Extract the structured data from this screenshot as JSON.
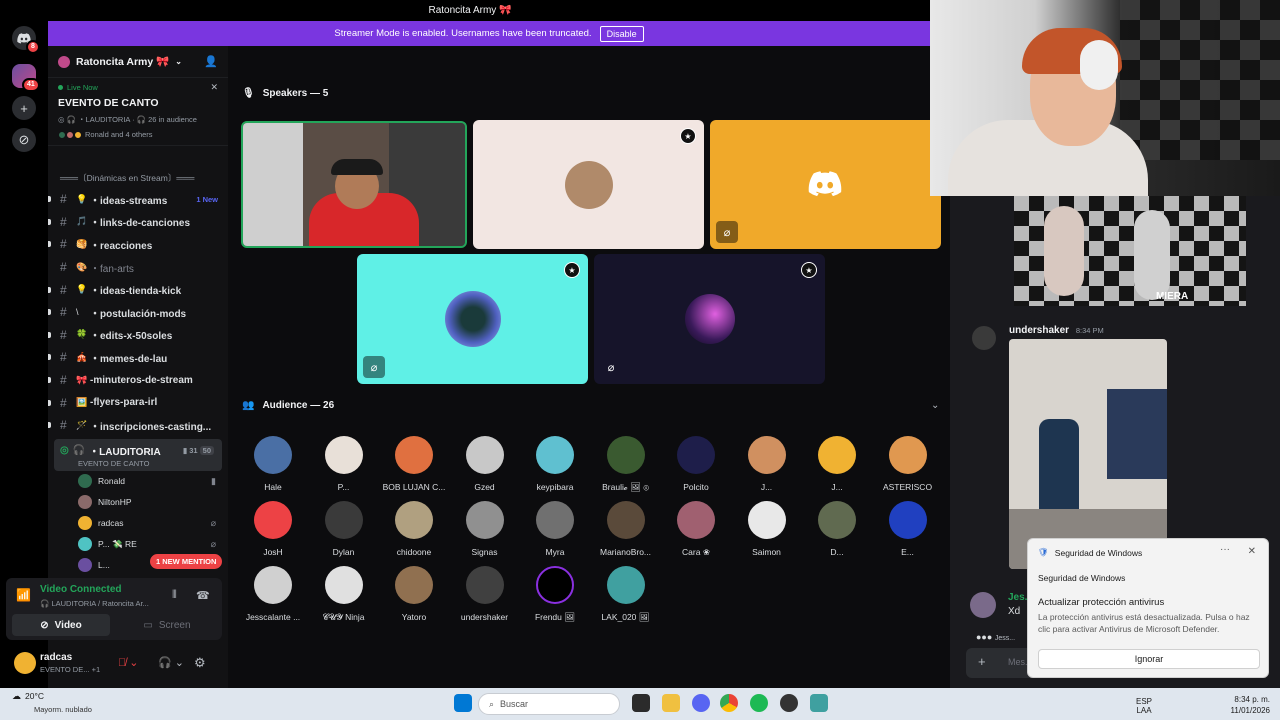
{
  "window": {
    "title": "Ratoncita Army 🎀"
  },
  "rail": {
    "badge_home": "8",
    "badge_server": "41"
  },
  "banner": {
    "text": "Streamer Mode is enabled. Usernames have been truncated.",
    "button": "Disable"
  },
  "server": {
    "name": "Ratoncita Army 🎀"
  },
  "live": {
    "status": "Live Now",
    "title": "EVENTO DE CANTO",
    "meta_channel": "LAUDITORIA",
    "meta_audience": "26 in audience",
    "others": "Ronald and 4 others"
  },
  "channels": {
    "category": "═══〔Dinámicas en Stream〕═══",
    "items": [
      {
        "emoji": "💡",
        "label": "・ideas-streams",
        "badge": "1 New",
        "bold": true
      },
      {
        "emoji": "🎵",
        "label": "・links-de-canciones",
        "bold": true
      },
      {
        "emoji": "🥞",
        "label": "・reacciones",
        "bold": true
      },
      {
        "emoji": "🎨",
        "label": "・fan-arts",
        "muted": true
      },
      {
        "emoji": "💡",
        "label": "・ideas-tienda-kick",
        "bold": true
      },
      {
        "emoji": "\\",
        "label": "・postulación-mods",
        "bold": true
      },
      {
        "emoji": "🍀",
        "label": "・edits-x-50soles",
        "bold": true
      },
      {
        "emoji": "🎪",
        "label": "・memes-de-lau",
        "bold": true
      },
      {
        "emoji": "🎀",
        "label": "-minuteros-de-stream",
        "bold": true
      },
      {
        "emoji": "🖼️",
        "label": "-flyers-para-irl",
        "bold": true
      },
      {
        "emoji": "🪄",
        "label": "・inscripciones-casting...",
        "bold": true
      }
    ],
    "voice": {
      "label": "・LAUDITORIA",
      "sub": "EVENTO DE CANTO",
      "cam_count": "31",
      "count": "50"
    },
    "voice_users": [
      {
        "name": "Ronald",
        "color": "#2f6b4f"
      },
      {
        "name": "NiltonHP",
        "color": "#8a6a6a"
      },
      {
        "name": "radcas",
        "color": "#f0b232"
      },
      {
        "name": "P... 💸 RE",
        "color": "#4fc3c3"
      },
      {
        "name": "L...",
        "color": "#6a4fa0"
      }
    ],
    "mention": "1 NEW MENTION"
  },
  "voice_panel": {
    "status": "Video Connected",
    "location": "LAUDITORIA / Ratoncita Ar...",
    "video_label": "Video",
    "screen_label": "Screen"
  },
  "user": {
    "name": "radcas",
    "status": "EVENTO DE...",
    "plus": "+1"
  },
  "stage": {
    "speakers_label": "Speakers — 5",
    "audience_label": "Audience — 26",
    "audience": [
      {
        "name": "Hale",
        "color": "#4a6fa5"
      },
      {
        "name": "P...",
        "color": "#e8e0d8"
      },
      {
        "name": "BOB LUJAN C...",
        "color": "#e07040"
      },
      {
        "name": "Gzed",
        "color": "#c8c8c8"
      },
      {
        "name": "keypibara",
        "color": "#5fc0d0"
      },
      {
        "name": "Brauli𝓸 🖼 ⊚",
        "color": "#3a5a30"
      },
      {
        "name": "Polcito",
        "color": "#1e1e4a"
      },
      {
        "name": "J...",
        "color": "#d09060"
      },
      {
        "name": "J...",
        "color": "#f0b232"
      },
      {
        "name": "ASTERISCO",
        "color": "#e09850"
      },
      {
        "name": "JosH",
        "color": "#ed4245"
      },
      {
        "name": "Dylan",
        "color": "#3a3a3a"
      },
      {
        "name": "chidoone",
        "color": "#b0a080"
      },
      {
        "name": "Signas",
        "color": "#909090"
      },
      {
        "name": "Myra",
        "color": "#707070"
      },
      {
        "name": "MarianoBro...",
        "color": "#5a4a3a"
      },
      {
        "name": "Cara ❀",
        "color": "#a06070"
      },
      {
        "name": "Saimon",
        "color": "#e8e8e8"
      },
      {
        "name": "D...",
        "color": "#606a50"
      },
      {
        "name": "E...",
        "color": "#2040c0"
      },
      {
        "name": "Jesscalante ...",
        "color": "#d0d0d0"
      },
      {
        "name": "𝓒𝓤𝓨 Ninja",
        "color": "#e0e0e0"
      },
      {
        "name": "Yatoro",
        "color": "#907050"
      },
      {
        "name": "undershaker",
        "color": "#404040"
      },
      {
        "name": "Frendu 🖼",
        "color": "#6020a0"
      },
      {
        "name": "LAK_020 🖼",
        "color": "#40a0a0"
      }
    ]
  },
  "chat": {
    "author": "undershaker",
    "time": "8:34 PM",
    "author2": "Jes...",
    "text2": "Xd",
    "typing": "Jess...",
    "cam_overlay": "MIERA",
    "input_placeholder": "Mes..."
  },
  "toast": {
    "app": "Seguridad de Windows",
    "subheader": "Seguridad de Windows",
    "title": "Actualizar protección antivirus",
    "body": "La protección antivirus está desactualizada. Pulsa o haz clic para activar Antivirus de Microsoft Defender.",
    "button": "Ignorar"
  },
  "taskbar": {
    "temp": "20°C",
    "weather": "Mayorm. nublado",
    "search": "Buscar",
    "lang1": "ESP",
    "lang2": "LAA",
    "time": "8:34 p. m.",
    "date": "11/01/2026"
  },
  "colors": {
    "accent": "#7a36e0",
    "green": "#23a55a",
    "red": "#ed4245",
    "blurple": "#5865f2"
  }
}
